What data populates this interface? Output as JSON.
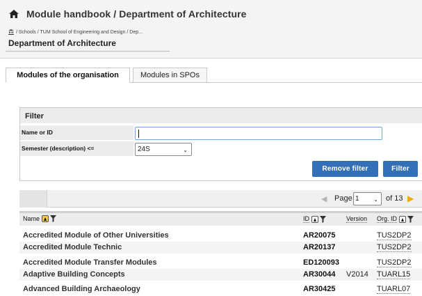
{
  "header": {
    "title": "Module handbook / Department of Architecture",
    "breadcrumb": "/ Schools / TUM School of Engineering and Design / Dep...",
    "org_title": "Department of Architecture"
  },
  "tabs": [
    {
      "label": "Modules of the organisation",
      "active": true
    },
    {
      "label": "Modules in SPOs",
      "active": false
    }
  ],
  "filter": {
    "heading": "Filter",
    "name_label": "Name or ID",
    "name_value": "",
    "semester_label": "Semester (description) <=",
    "semester_value": "24S",
    "remove_label": "Remove filter",
    "filter_label": "Filter"
  },
  "pager": {
    "page_label": "Page",
    "current_page": "1",
    "of_text": "of 13"
  },
  "table": {
    "columns": {
      "name": "Name",
      "id": "ID",
      "version": "Version",
      "org": "Org. ID"
    },
    "rows": [
      {
        "name": "Accredited Module of Other Universities",
        "id": "AR20075",
        "version": "",
        "org": "TUS2DP2"
      },
      {
        "name": "Accredited Module Technic",
        "id": "AR20137",
        "version": "",
        "org": "TUS2DP2"
      },
      {
        "name": "Accredited Module Transfer Modules",
        "id": "ED120093",
        "version": "",
        "org": "TUS2DP2"
      },
      {
        "name": "Adaptive Building Concepts",
        "id": "AR30044",
        "version": "V2014",
        "org": "TUARL15"
      },
      {
        "name": "Advanced Building Archaeology",
        "id": "AR30425",
        "version": "",
        "org": "TUARL07"
      }
    ]
  },
  "colors": {
    "button_blue": "#3370b7",
    "next_arrow": "#f0a800",
    "sort_active": "#f7c74d"
  },
  "icons": [
    "home-icon",
    "bank-icon",
    "prev-page-icon",
    "next-page-icon",
    "sort-asc-icon",
    "filter-funnel-icon",
    "chevron-down-icon"
  ]
}
